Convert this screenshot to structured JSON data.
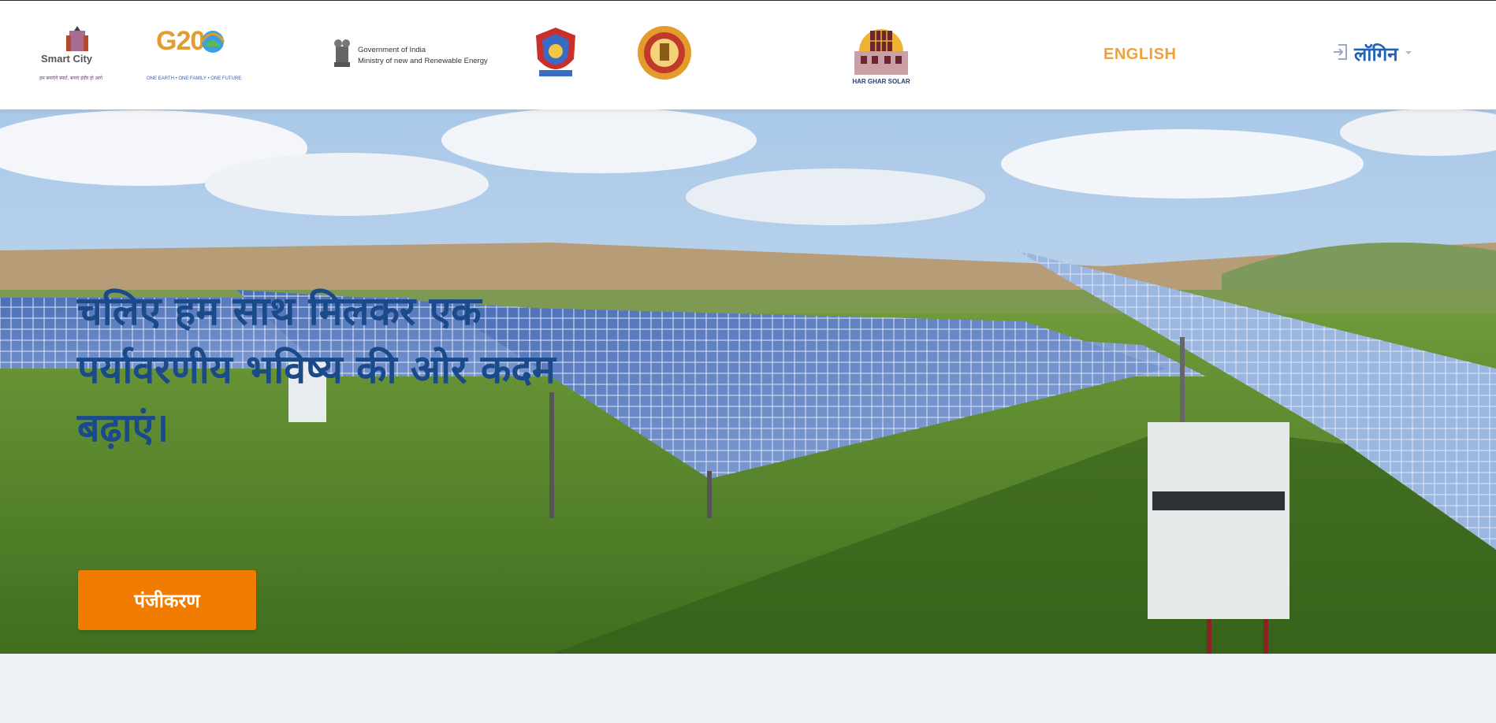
{
  "header": {
    "logos": {
      "smart_city": "Smart City",
      "smart_city_tagline": "हम बनाएंगे स्मार्ट, बनाएं इंदौर हो आगे",
      "g20": "G20",
      "g20_tagline": "ONE EARTH • ONE FAMILY • ONE FUTURE",
      "goi_line1": "Government of India",
      "goi_line2": "Ministry of new and Renewable Energy",
      "har_ghar_solar": "HAR GHAR SOLAR"
    },
    "language_toggle": "ENGLISH",
    "login_label": "लॉगिन"
  },
  "hero": {
    "title": "चलिए हम साथ मिलकर एक पर्यावरणीय भविष्य की ओर कदम बढ़ाएं।",
    "register_button": "पंजीकरण"
  },
  "colors": {
    "brand_orange": "#ef7c00",
    "lang_gold": "#f0a23a",
    "login_blue": "#1f61b7",
    "title_blue": "#1a4a8a",
    "page_bg": "#eef1f6"
  },
  "icons": {
    "login": "login-arrow-icon",
    "dropdown": "chevron-down-icon"
  }
}
